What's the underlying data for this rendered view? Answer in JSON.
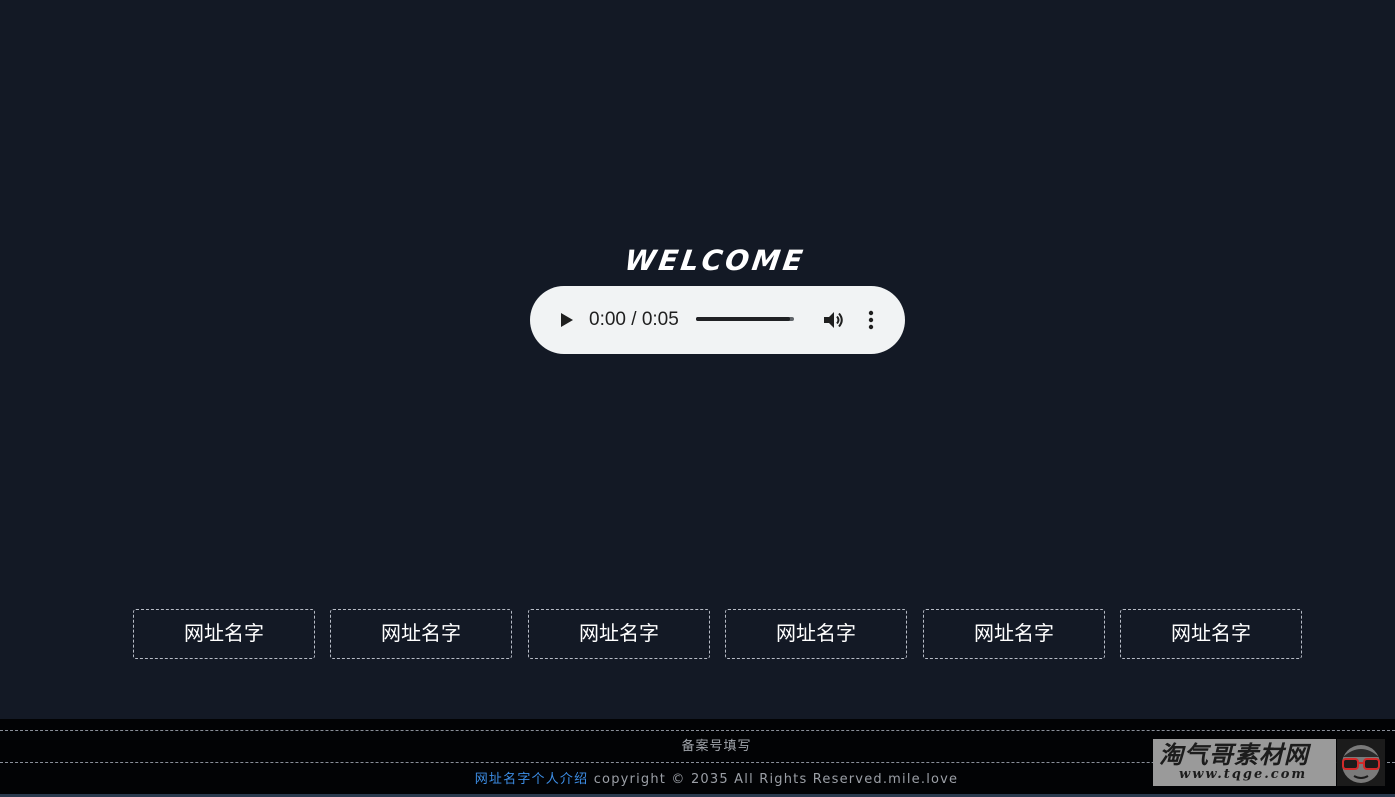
{
  "hero": {
    "welcome": "WELCOME"
  },
  "audio": {
    "time": "0:00 / 0:05",
    "progress": 0.96,
    "icons": [
      "play-icon",
      "volume-icon",
      "more-vert-icon"
    ]
  },
  "links": [
    {
      "label": "网址名字"
    },
    {
      "label": "网址名字"
    },
    {
      "label": "网址名字"
    },
    {
      "label": "网址名字"
    },
    {
      "label": "网址名字"
    },
    {
      "label": "网址名字"
    }
  ],
  "footer": {
    "icp": "备案号填写",
    "intro_link": "网址名字个人介绍",
    "copyright": "copyright © 2035 All Rights Reserved.mile.love"
  },
  "watermark": {
    "title": "淘气哥素材网",
    "url": "www.tqge.com"
  },
  "colors": {
    "background": "#131925",
    "footer": "#020305",
    "link_accent": "#3d8ee6",
    "player": "#f1f3f4"
  }
}
